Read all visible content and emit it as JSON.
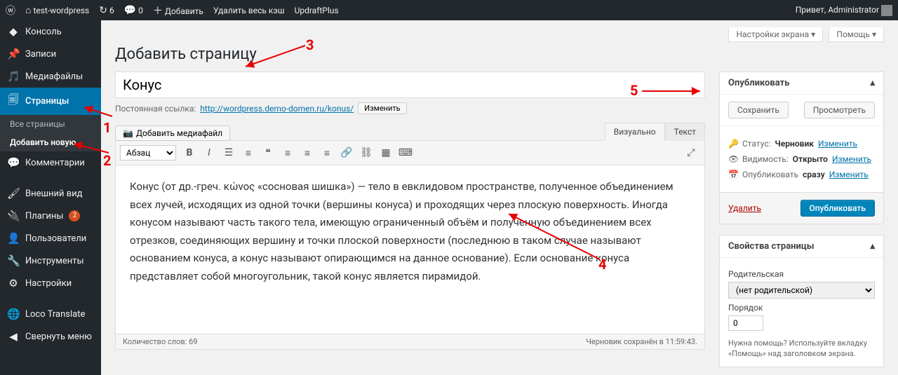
{
  "adminbar": {
    "site_name": "test-wordpress",
    "updates_count": "6",
    "comments_count": "0",
    "add_new": "Добавить",
    "clear_cache": "Удалить весь кэш",
    "updraft": "UpdraftPlus",
    "greeting": "Привет, Administrator"
  },
  "sidemenu": {
    "dashboard": "Консоль",
    "posts": "Записи",
    "media": "Медиафайлы",
    "pages": "Страницы",
    "pages_sub_all": "Все страницы",
    "pages_sub_add": "Добавить новую",
    "comments": "Комментарии",
    "appearance": "Внешний вид",
    "plugins": "Плагины",
    "plugins_badge": "2",
    "users": "Пользователи",
    "tools": "Инструменты",
    "settings": "Настройки",
    "loco": "Loco Translate",
    "collapse": "Свернуть меню"
  },
  "screen": {
    "options": "Настройки экрана",
    "help": "Помощь"
  },
  "page": {
    "heading": "Добавить страницу",
    "title_value": "Конус",
    "permalink_label": "Постоянная ссылка:",
    "permalink_url": "http://wordpress.demo-domen.ru/konus/",
    "permalink_edit": "Изменить",
    "add_media": "Добавить медиафайл",
    "tab_visual": "Визуально",
    "tab_text": "Текст",
    "format_select": "Абзац",
    "body_text": "Конус (от др.-греч. κώνος «сосновая шишка») — тело в евклидовом пространстве, полученное объединением всех лучей, исходящих из одной точки (вершины конуса) и проходящих через плоскую поверхность. Иногда конусом называют часть такого тела, имеющую ограниченный объём и полученную объединением всех отрезков, соединяющих вершину и точки плоской поверхности (последнюю в таком случае называют основанием конуса, а конус называют опирающимся на данное основание). Если основание конуса представляет собой многоугольник, такой конус является пирамидой.",
    "word_count_label": "Количество слов:",
    "word_count": "69",
    "save_status": "Черновик сохранён в 11:59:43."
  },
  "publish": {
    "box_title": "Опубликовать",
    "save": "Сохранить",
    "preview": "Просмотреть",
    "status_label": "Статус:",
    "status_value": "Черновик",
    "visibility_label": "Видимость:",
    "visibility_value": "Открыто",
    "schedule_label": "Опубликовать",
    "schedule_value": "сразу",
    "edit": "Изменить",
    "delete": "Удалить",
    "publish_btn": "Опубликовать"
  },
  "attrs": {
    "box_title": "Свойства страницы",
    "parent_label": "Родительская",
    "parent_value": "(нет родительской)",
    "order_label": "Порядок",
    "order_value": "0",
    "help": "Нужна помощь? Используйте вкладку «Помощь» над заголовком экрана."
  },
  "annotations": {
    "n1": "1",
    "n2": "2",
    "n3": "3",
    "n4": "4",
    "n5": "5"
  }
}
